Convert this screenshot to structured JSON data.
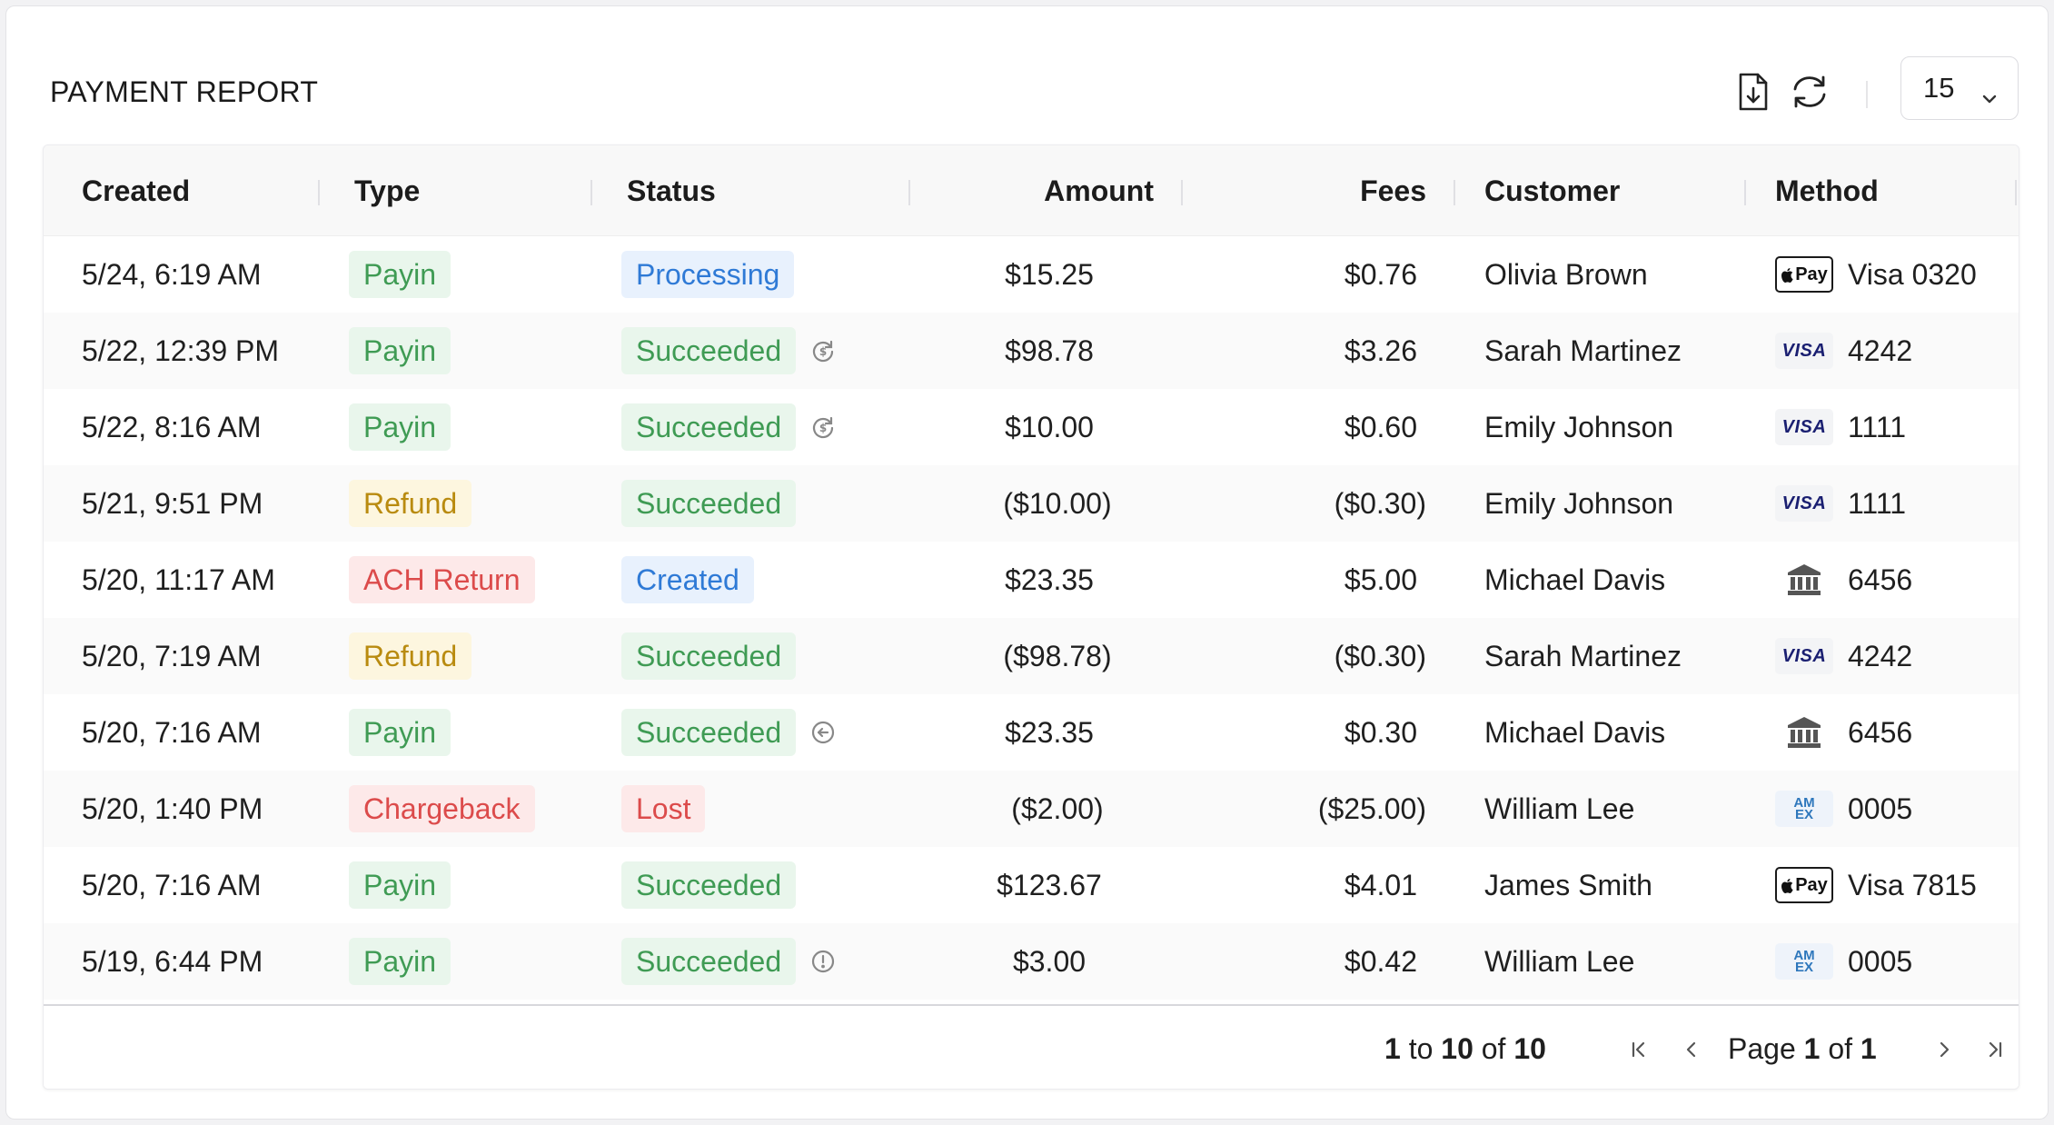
{
  "report": {
    "title": "PAYMENT REPORT",
    "page_size": "15",
    "icons": {
      "download": "file-download-icon",
      "refresh": "refresh-icon",
      "dropdown": "chevron-down-icon"
    }
  },
  "columns": [
    "Created",
    "Type",
    "Status",
    "Amount",
    "Fees",
    "Customer",
    "Method"
  ],
  "colors": {
    "payin_bg": "#e9f6ec",
    "payin_fg": "#3f9b54",
    "refund_bg": "#fdf6df",
    "refund_fg": "#b98b10",
    "danger_bg": "#fde9e9",
    "danger_fg": "#dc4b4b",
    "info_bg": "#e8f1fd",
    "info_fg": "#2f7ad6"
  },
  "rows": [
    {
      "created": "5/24, 6:19 AM",
      "type": "Payin",
      "type_style": "payin",
      "status": "Processing",
      "status_style": "info",
      "status_icon": "",
      "amount": "$15.25",
      "fees": "$0.76",
      "customer": "Olivia Brown",
      "method_brand": "applepay",
      "method": "Visa 0320"
    },
    {
      "created": "5/22, 12:39 PM",
      "type": "Payin",
      "type_style": "payin",
      "status": "Succeeded",
      "status_style": "payin",
      "status_icon": "refund-cycle-icon",
      "amount": "$98.78",
      "fees": "$3.26",
      "customer": "Sarah Martinez",
      "method_brand": "visa",
      "method": "4242"
    },
    {
      "created": "5/22, 8:16 AM",
      "type": "Payin",
      "type_style": "payin",
      "status": "Succeeded",
      "status_style": "payin",
      "status_icon": "refund-cycle-icon",
      "amount": "$10.00",
      "fees": "$0.60",
      "customer": "Emily Johnson",
      "method_brand": "visa",
      "method": "1111"
    },
    {
      "created": "5/21, 9:51 PM",
      "type": "Refund",
      "type_style": "refund",
      "status": "Succeeded",
      "status_style": "payin",
      "status_icon": "",
      "amount": "($10.00)",
      "fees": "($0.30)",
      "customer": "Emily Johnson",
      "method_brand": "visa",
      "method": "1111"
    },
    {
      "created": "5/20, 11:17 AM",
      "type": "ACH Return",
      "type_style": "danger",
      "status": "Created",
      "status_style": "info",
      "status_icon": "",
      "amount": "$23.35",
      "fees": "$5.00",
      "customer": "Michael Davis",
      "method_brand": "bank",
      "method": "6456"
    },
    {
      "created": "5/20, 7:19 AM",
      "type": "Refund",
      "type_style": "refund",
      "status": "Succeeded",
      "status_style": "payin",
      "status_icon": "",
      "amount": "($98.78)",
      "fees": "($0.30)",
      "customer": "Sarah Martinez",
      "method_brand": "visa",
      "method": "4242"
    },
    {
      "created": "5/20, 7:16 AM",
      "type": "Payin",
      "type_style": "payin",
      "status": "Succeeded",
      "status_style": "payin",
      "status_icon": "return-arrow-icon",
      "amount": "$23.35",
      "fees": "$0.30",
      "customer": "Michael Davis",
      "method_brand": "bank",
      "method": "6456"
    },
    {
      "created": "5/20, 1:40 PM",
      "type": "Chargeback",
      "type_style": "danger",
      "status": "Lost",
      "status_style": "danger",
      "status_icon": "",
      "amount": "($2.00)",
      "fees": "($25.00)",
      "customer": "William Lee",
      "method_brand": "amex",
      "method": "0005"
    },
    {
      "created": "5/20, 7:16 AM",
      "type": "Payin",
      "type_style": "payin",
      "status": "Succeeded",
      "status_style": "payin",
      "status_icon": "",
      "amount": "$123.67",
      "fees": "$4.01",
      "customer": "James Smith",
      "method_brand": "applepay",
      "method": "Visa 7815"
    },
    {
      "created": "5/19, 6:44 PM",
      "type": "Payin",
      "type_style": "payin",
      "status": "Succeeded",
      "status_style": "payin",
      "status_icon": "alert-circle-icon",
      "amount": "$3.00",
      "fees": "$0.42",
      "customer": "William Lee",
      "method_brand": "amex",
      "method": "0005"
    }
  ],
  "brand_labels": {
    "applepay": "Pay",
    "visa": "VISA",
    "amex_top": "AM",
    "amex_bottom": "EX"
  },
  "pagination": {
    "range_from": "1",
    "range_to_word": "to",
    "range_to": "10",
    "range_of_word": "of",
    "total": "10",
    "page_word": "Page",
    "page": "1",
    "page_of_word": "of",
    "page_total": "1"
  }
}
